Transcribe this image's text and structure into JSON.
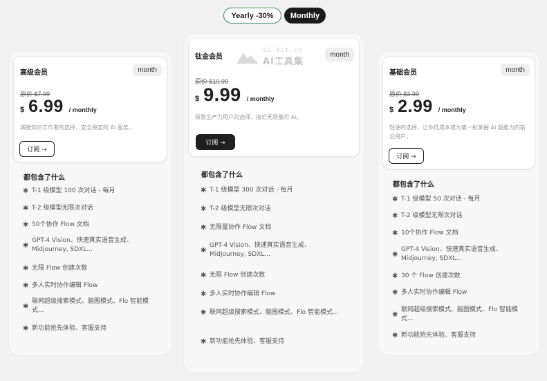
{
  "billing_toggle": {
    "yearly_label": "Yearly -30%",
    "monthly_label": "Monthly",
    "selected": "Monthly"
  },
  "watermark": {
    "domain": "ai-bot.cn",
    "name": "AI工具集"
  },
  "plans": [
    {
      "name": "高级会员",
      "period_badge": "month",
      "original_price": "原价 $7.99",
      "currency": "$",
      "price": "6.99",
      "unit": "/ monthly",
      "description": "减缓知识工作者的选择，安全稳定的 AI 服务。",
      "subscribe_label": "订阅 →",
      "features_title": "都包含了什么",
      "features": [
        "T-1 级模型 100 次对话 - 每月",
        "T-2 级模型无限次对话",
        "50个协作 Flow 文档",
        "GPT-4 Vision、快速真实语音生成、Midjourney, SDXL...",
        "无限 Flow 创建次数",
        "多人实时协作编辑 Flow",
        "联网超级搜索模式、脑图模式、Flo 智能模式...",
        "新功能抢先体验、客服支持"
      ]
    },
    {
      "name": "钛金会员",
      "period_badge": "month",
      "original_price": "原价 $10.99",
      "currency": "$",
      "price": "9.99",
      "unit": "/ monthly",
      "description": "极致生产力用户的选择，接近无限量的 AI。",
      "subscribe_label": "订阅 →",
      "features_title": "都包含了什么",
      "features": [
        "T-1 级模型 300 次对话 - 每月",
        "T-2 级模型无限次对话",
        "无限量协作 Flow 文档",
        "GPT-4 Vision、快速真实语音生成、Midjourney, SDXL...",
        "无限 Flow 创建次数",
        "多人实时协作编辑 Flow",
        "联网超级搜索模式、脑图模式、Flo 智能模式...",
        "新功能抢先体验、客服支持"
      ]
    },
    {
      "name": "基础会员",
      "period_badge": "month",
      "original_price": "原价 $3.99",
      "currency": "$",
      "price": "2.99",
      "unit": "/ monthly",
      "description": "轻便的选择，让你低成本成为第一批掌握 AI 超能力的前沿用户。",
      "subscribe_label": "订阅 →",
      "features_title": "都包含了什么",
      "features": [
        "T-1 级模型 50 次对话 - 每月",
        "T-2 级模型无限次对话",
        "10个协作 Flow 文档",
        "GPT-4 Vision、快速真实语音生成、Midjourney, SDXL...",
        "30 个 Flow 创建次数",
        "多人实时协作编辑 Flow",
        "联网超级搜索模式、脑图模式、Flo 智能模式...",
        "新功能抢先体验、客服支持"
      ]
    }
  ],
  "colors": {
    "yearly_border": "#3a8a55",
    "dark": "#1f1f1f",
    "background": "#f1f1f1"
  }
}
